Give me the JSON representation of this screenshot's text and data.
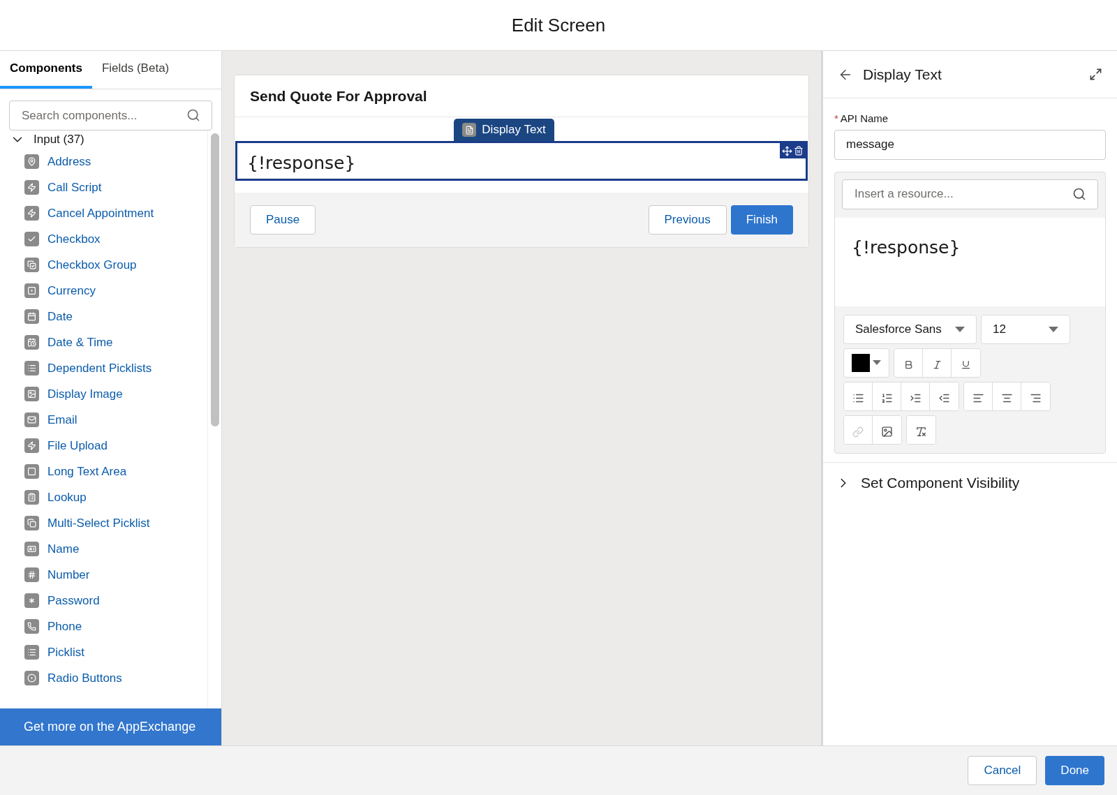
{
  "header": {
    "title": "Edit Screen"
  },
  "left_panel": {
    "tabs": [
      {
        "label": "Components",
        "selected": true
      },
      {
        "label": "Fields (Beta)",
        "selected": false
      }
    ],
    "search": {
      "placeholder": "Search components..."
    },
    "section": {
      "label": "Input (37)",
      "expanded": true
    },
    "items": [
      "Address",
      "Call Script",
      "Cancel Appointment",
      "Checkbox",
      "Checkbox Group",
      "Currency",
      "Date",
      "Date & Time",
      "Dependent Picklists",
      "Display Image",
      "Email",
      "File Upload",
      "Long Text Area",
      "Lookup",
      "Multi-Select Picklist",
      "Name",
      "Number",
      "Password",
      "Phone",
      "Picklist",
      "Radio Buttons"
    ],
    "appexchange": "Get more on the AppExchange"
  },
  "canvas": {
    "screen_title": "Send Quote For Approval",
    "component_tag": "Display Text",
    "component_text": "{!response}",
    "buttons": {
      "pause": "Pause",
      "previous": "Previous",
      "finish": "Finish"
    }
  },
  "properties": {
    "title": "Display Text",
    "required_mark": "*",
    "api_name_label": "API Name",
    "api_name_value": "message",
    "resource_placeholder": "Insert a resource...",
    "editor_text": "{!response}",
    "font": "Salesforce Sans",
    "size": "12",
    "link_disabled": true,
    "visibility": {
      "label": "Set Component Visibility",
      "expanded": false
    }
  },
  "footer": {
    "cancel": "Cancel",
    "done": "Done"
  }
}
